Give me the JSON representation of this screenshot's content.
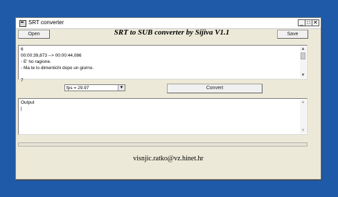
{
  "window": {
    "title": "SRT converter",
    "minimize": "_",
    "maximize": "□",
    "close": "✕"
  },
  "toolbar": {
    "open_label": "Open",
    "heading": "SRT to SUB converter by Sijiva V1.1",
    "save_label": "Save"
  },
  "input": {
    "lines": "6\n00:00:39,873 --> 00:00:44,086\n- E' ho ragione.\n- Ma te lo dimentichi dopo un giorno.\n\n7"
  },
  "controls": {
    "fps_value": "fps = 29.97",
    "convert_label": "Convert"
  },
  "output": {
    "text": "Output\n|"
  },
  "footer": {
    "email": "visnjic.ratko@vz.hinet.hr"
  },
  "icons": {
    "app": "app-window-icon",
    "dropdown": "chevron-down-icon",
    "scroll_up": "scroll-up-icon",
    "scroll_down": "scroll-down-icon"
  }
}
